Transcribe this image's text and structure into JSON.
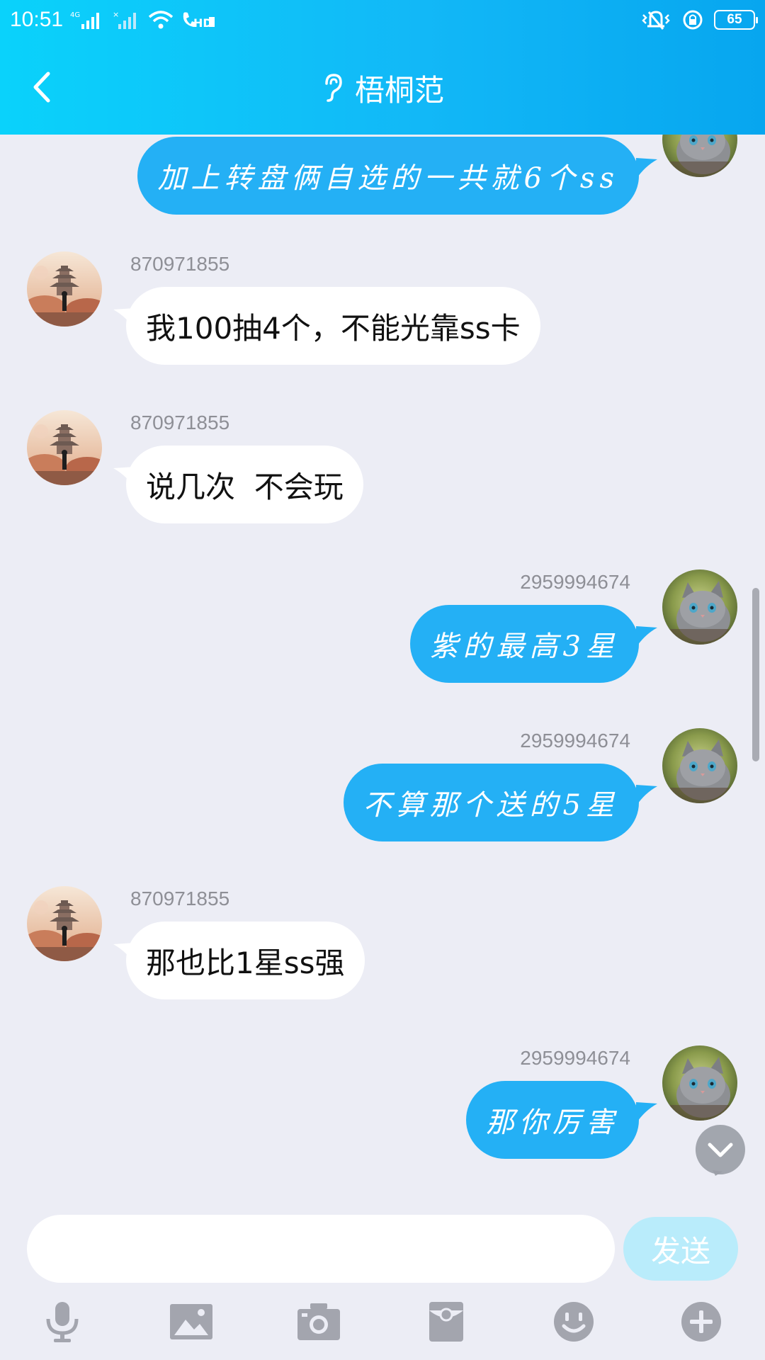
{
  "status_bar": {
    "time": "10:51",
    "network": "4G",
    "battery": "65"
  },
  "header": {
    "title": "梧桐范",
    "back_icon": "chevron-left-icon",
    "mode_icon": "ear-icon"
  },
  "messages": [
    {
      "side": "right",
      "sender": "",
      "text": "加上转盘俩自选的一共就6个ss"
    },
    {
      "side": "left",
      "sender": "870971855",
      "text": "我100抽4个，不能光靠ss卡"
    },
    {
      "side": "left",
      "sender": "870971855",
      "text": "说几次  不会玩"
    },
    {
      "side": "right",
      "sender": "2959994674",
      "text": "紫的最高3星"
    },
    {
      "side": "right",
      "sender": "2959994674",
      "text": "不算那个送的5星"
    },
    {
      "side": "left",
      "sender": "870971855",
      "text": "那也比1星ss强"
    },
    {
      "side": "right",
      "sender": "2959994674",
      "text": "那你厉害"
    }
  ],
  "composer": {
    "input_value": "",
    "send_label": "发送"
  },
  "toolbar": {
    "icons": [
      "microphone-icon",
      "image-icon",
      "camera-icon",
      "red-packet-icon",
      "emoji-icon",
      "plus-icon"
    ]
  },
  "colors": {
    "header_gradient_start": "#0ad2fb",
    "header_gradient_end": "#07a6ef",
    "outgoing_bubble": "#24b0f5",
    "incoming_bubble": "#ffffff",
    "chat_background": "#ecedf5",
    "send_button_disabled": "#b9ecfb",
    "toolbar_icon": "#a3a5ae"
  }
}
